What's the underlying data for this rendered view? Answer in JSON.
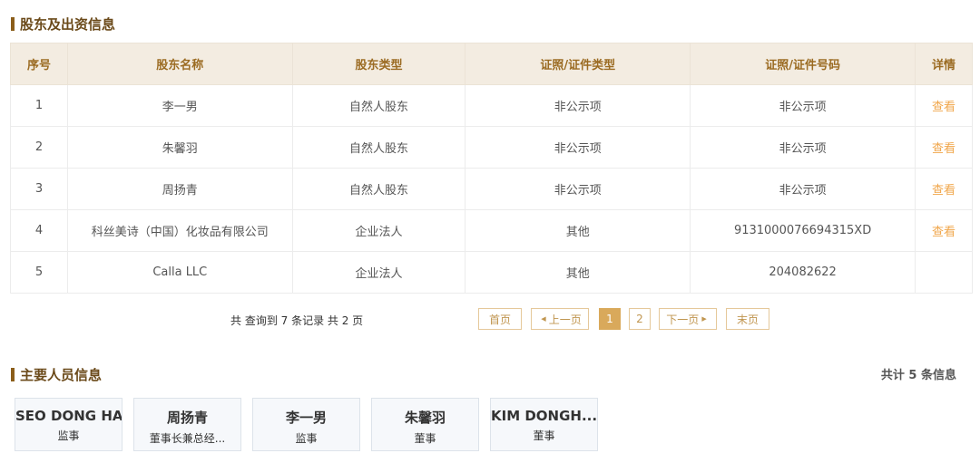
{
  "shareholder_section": {
    "title": "股东及出资信息",
    "columns": [
      "序号",
      "股东名称",
      "股东类型",
      "证照/证件类型",
      "证照/证件号码",
      "详情"
    ],
    "rows": [
      {
        "no": "1",
        "name": "李一男",
        "type": "自然人股东",
        "id_type": "非公示项",
        "id_no": "非公示项",
        "detail": "查看"
      },
      {
        "no": "2",
        "name": "朱馨羽",
        "type": "自然人股东",
        "id_type": "非公示项",
        "id_no": "非公示项",
        "detail": "查看"
      },
      {
        "no": "3",
        "name": "周扬青",
        "type": "自然人股东",
        "id_type": "非公示项",
        "id_no": "非公示项",
        "detail": "查看"
      },
      {
        "no": "4",
        "name": "科丝美诗（中国）化妆品有限公司",
        "type": "企业法人",
        "id_type": "其他",
        "id_no": "9131000076694315XD",
        "detail": "查看"
      },
      {
        "no": "5",
        "name": "Calla LLC",
        "type": "企业法人",
        "id_type": "其他",
        "id_no": "204082622",
        "detail": ""
      }
    ]
  },
  "pagination": {
    "summary": "共 查询到 7 条记录 共 2 页",
    "first": "首页",
    "prev": "上一页",
    "page1": "1",
    "page2": "2",
    "next": "下一页",
    "last": "末页"
  },
  "personnel_section": {
    "title": "主要人员信息",
    "total": "共计 5 条信息",
    "people": [
      {
        "name": "SEO DONG HA",
        "role": "监事"
      },
      {
        "name": "周扬青",
        "role": "董事长兼总经..."
      },
      {
        "name": "李一男",
        "role": "监事"
      },
      {
        "name": "朱馨羽",
        "role": "董事"
      },
      {
        "name": "KIM DONGH...",
        "role": "董事"
      }
    ]
  },
  "colors": {
    "accent": "#8b5e1a",
    "header_bg": "#f3ece1",
    "header_text": "#9b6b22",
    "link": "#f0a64a",
    "pager_active": "#d9a95b"
  }
}
